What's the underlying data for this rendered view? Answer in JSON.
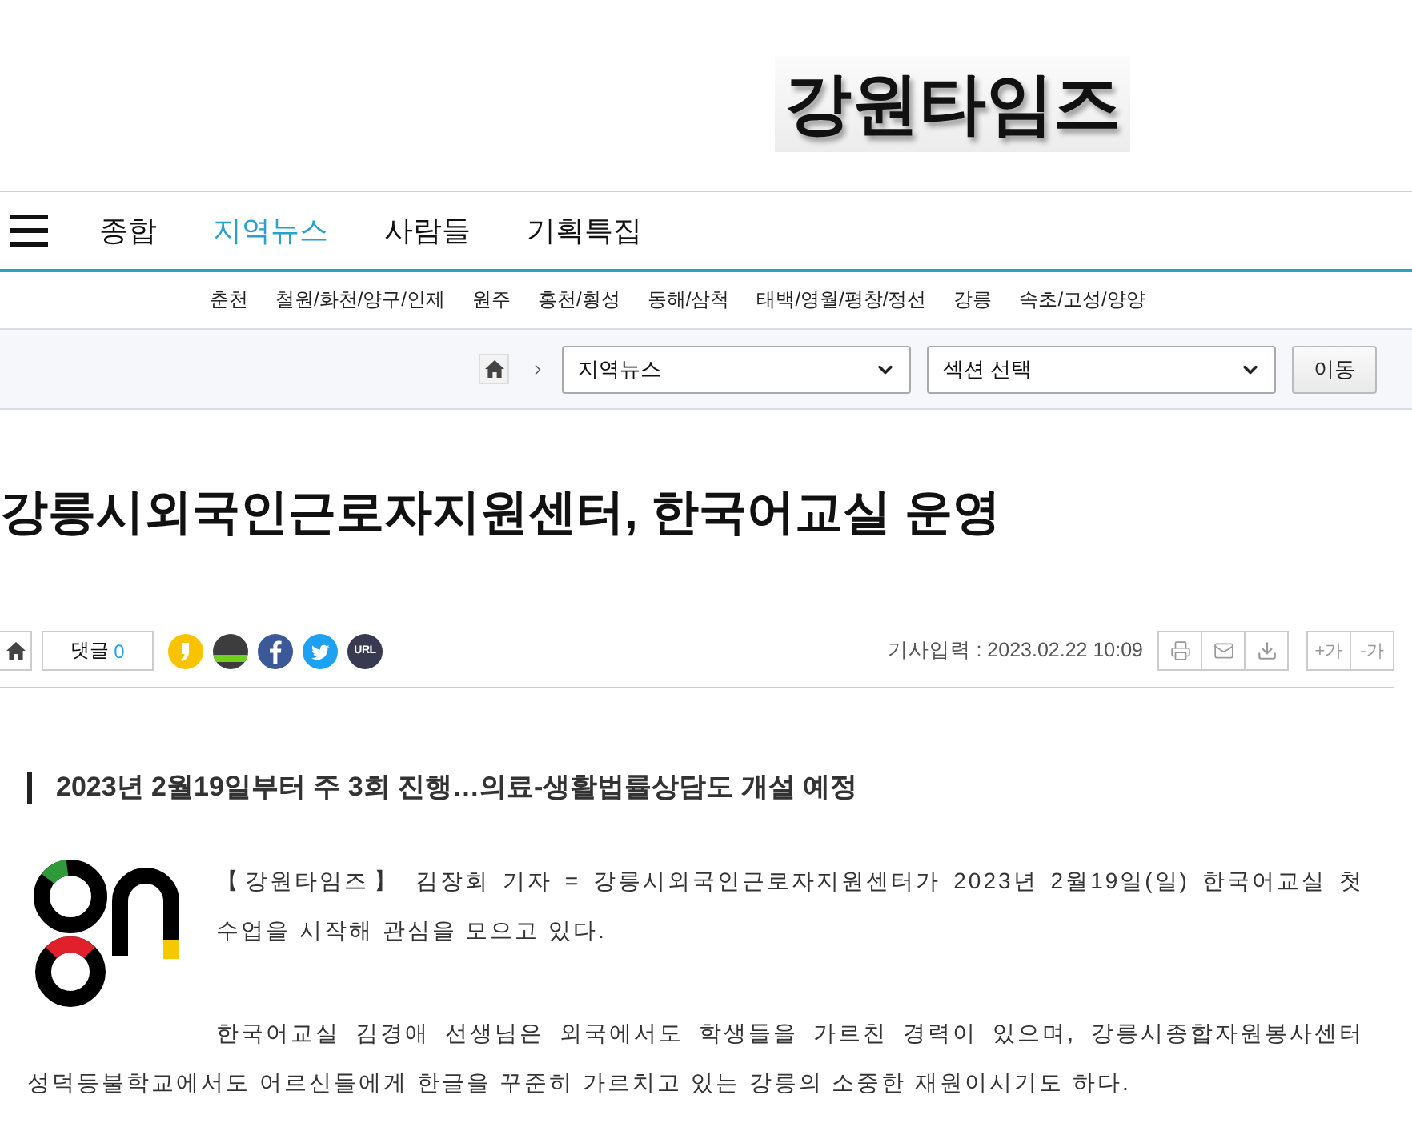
{
  "masthead": {
    "logo_text": "강원타임즈"
  },
  "main_nav": {
    "items": [
      {
        "label": "종합",
        "selected": false
      },
      {
        "label": "지역뉴스",
        "selected": true
      },
      {
        "label": "사람들",
        "selected": false
      },
      {
        "label": "기획특집",
        "selected": false
      }
    ]
  },
  "sub_nav": {
    "items": [
      "춘천",
      "철원/화천/양구/인제",
      "원주",
      "홍천/횡성",
      "동해/삼척",
      "태백/영월/평창/정선",
      "강릉",
      "속초/고성/양양"
    ]
  },
  "breadcrumb": {
    "section_select": {
      "value": "지역뉴스"
    },
    "subsection_select": {
      "value": "섹션 선택"
    },
    "go_button": "이동"
  },
  "article": {
    "title": "강릉시외국인근로자지원센터, 한국어교실 운영",
    "toolbar": {
      "comment_label": "댓글",
      "comment_count": "0",
      "url_button": "URL",
      "published": "기사입력 : 2023.02.22 10:09",
      "font_buttons": [
        "+가",
        "-가"
      ]
    },
    "subtitle": "2023년 2월19일부터 주 3회 진행…의료-생활법률상담도 개설 예정",
    "paragraphs": [
      "【강원타임즈】 김장회 기자 = 강릉시외국인근로자지원센터가 2023년 2월19일(일) 한국어교실 첫 수업을 시작해 관심을 모으고 있다.",
      "한국어교실 김경애 선생님은 외국에서도 학생들을 가르친 경력이 있으며, 강릉시종합자원봉사센터 성덕등불학교에서도 어르신들에게 한글을 꾸준히 가르치고 있는 강릉의 소중한 재원이시기도 하다."
    ]
  }
}
